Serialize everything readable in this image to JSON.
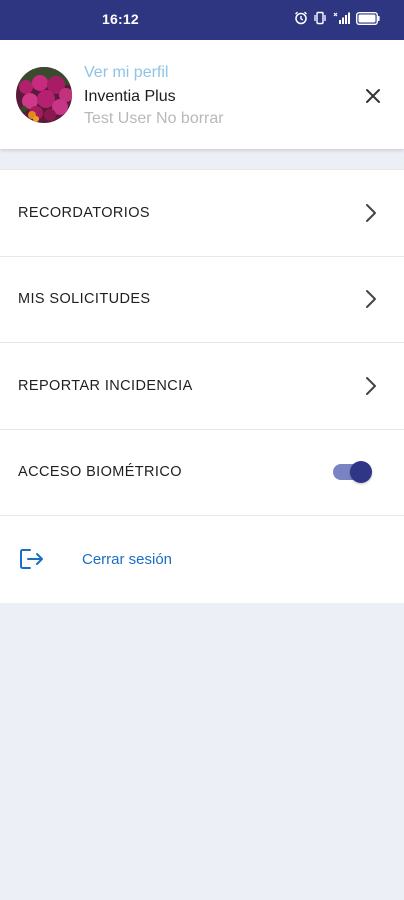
{
  "status_bar": {
    "time": "16:12",
    "icons": [
      "alarm-icon",
      "vibrate-icon",
      "signal-icon",
      "battery-icon"
    ],
    "battery_label": "100"
  },
  "profile": {
    "view_profile_label": "Ver mi perfil",
    "name": "Inventia Plus",
    "subtitle": "Test User No borrar",
    "avatar_icon": "flower-photo",
    "close_icon": "close-icon"
  },
  "menu": {
    "items": [
      {
        "label": "RECORDATORIOS",
        "icon": "chevron-right-icon"
      },
      {
        "label": "MIS SOLICITUDES",
        "icon": "chevron-right-icon"
      },
      {
        "label": "REPORTAR INCIDENCIA",
        "icon": "chevron-right-icon"
      }
    ],
    "biometric": {
      "label": "ACCESO BIOMÉTRICO",
      "enabled": true
    },
    "logout": {
      "label": "Cerrar sesión",
      "icon": "logout-icon"
    }
  },
  "colors": {
    "status_bar": "#2e3682",
    "background": "#ecf0f6",
    "link_blue": "#1a6fc4",
    "view_profile": "#8fc3e6",
    "toggle_on": "#2e3685"
  }
}
